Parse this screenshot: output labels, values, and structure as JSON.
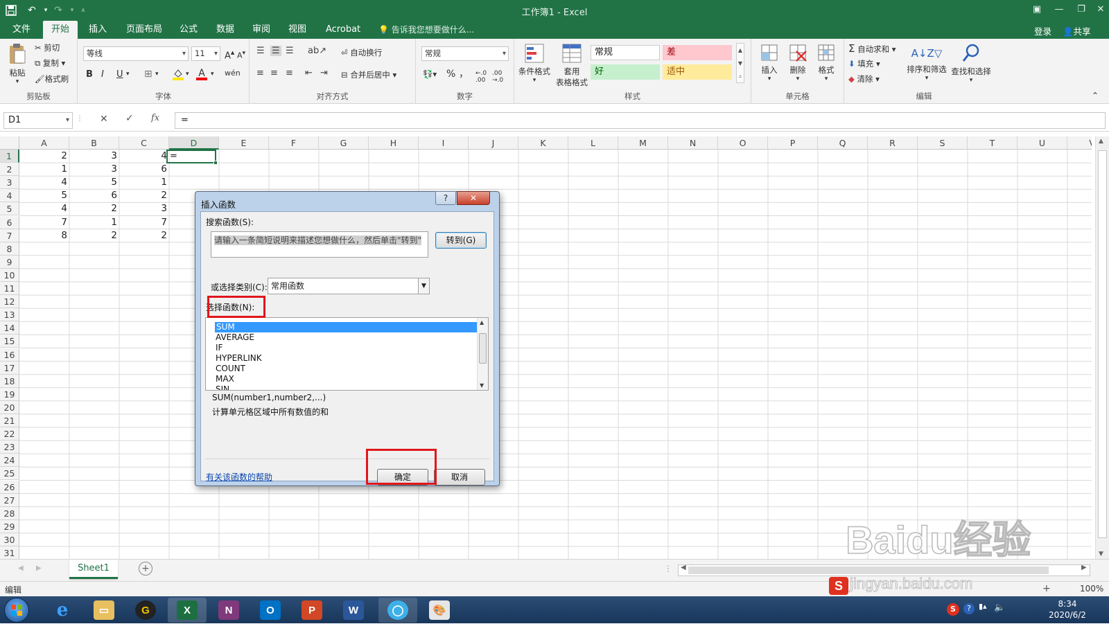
{
  "window": {
    "title": "工作簿1 - Excel"
  },
  "ribbon_tabs": [
    "文件",
    "开始",
    "插入",
    "页面布局",
    "公式",
    "数据",
    "审阅",
    "视图",
    "Acrobat"
  ],
  "tell_me": "告诉我您想要做什么...",
  "account": {
    "login": "登录",
    "share": "共享"
  },
  "clipboard": {
    "paste": "粘贴",
    "cut": "剪切",
    "copy": "复制",
    "format_painter": "格式刷",
    "label": "剪贴板"
  },
  "font": {
    "name": "等线",
    "size": "11",
    "label": "字体",
    "bold": "B",
    "italic": "I",
    "underline": "U"
  },
  "alignment": {
    "wrap": "自动换行",
    "merge": "合并后居中",
    "label": "对齐方式"
  },
  "number": {
    "format": "常规",
    "percent": "%",
    "comma": "，",
    "label": "数字"
  },
  "styles": {
    "conditional": "条件格式",
    "table1": "套用",
    "table2": "表格格式",
    "normal": "常规",
    "bad": "差",
    "good": "好",
    "neutral": "适中",
    "label": "样式"
  },
  "cells": {
    "insert": "插入",
    "delete": "删除",
    "format": "格式",
    "label": "单元格"
  },
  "editing": {
    "autosum": "自动求和",
    "fill": "填充",
    "clear": "清除",
    "sort": "排序和筛选",
    "find": "查找和选择",
    "label": "编辑"
  },
  "formula_bar": {
    "name_box": "D1",
    "fx": "fx",
    "content": "="
  },
  "columns": [
    "A",
    "B",
    "C",
    "D",
    "E",
    "F",
    "G",
    "H",
    "I",
    "J",
    "K",
    "L",
    "M",
    "N",
    "O",
    "P",
    "Q",
    "R",
    "S",
    "T",
    "U",
    "V"
  ],
  "rows": [
    "1",
    "2",
    "3",
    "4",
    "5",
    "6",
    "7",
    "8",
    "9",
    "10",
    "11",
    "12",
    "13",
    "14",
    "15",
    "16",
    "17",
    "18",
    "19",
    "20",
    "21",
    "22",
    "23",
    "24",
    "25",
    "26",
    "27",
    "28",
    "29",
    "30",
    "31"
  ],
  "sheet_values": [
    [
      "2",
      "3",
      "4"
    ],
    [
      "1",
      "3",
      "6"
    ],
    [
      "4",
      "5",
      "1"
    ],
    [
      "5",
      "6",
      "2"
    ],
    [
      "4",
      "2",
      "3"
    ],
    [
      "7",
      "1",
      "7"
    ],
    [
      "8",
      "2",
      "2"
    ]
  ],
  "active_cell": {
    "text": "="
  },
  "sheet_tabs": [
    "Sheet1"
  ],
  "status": {
    "mode": "编辑",
    "zoom": "100%"
  },
  "taskbar": {
    "time": "8:34",
    "date": "2020/6/2"
  },
  "dialog": {
    "title": "插入函数",
    "help_button": "?",
    "close_button": "✕",
    "search_label": "搜索函数(S):",
    "search_text": "请输入一条简短说明来描述您想做什么，然后单击\"转到\"",
    "go_button": "转到(G)",
    "category_label": "或选择类别(C):",
    "category_value": "常用函数",
    "select_label": "选择函数(N):",
    "functions": [
      "SUM",
      "AVERAGE",
      "IF",
      "HYPERLINK",
      "COUNT",
      "MAX",
      "SIN"
    ],
    "signature": "SUM(number1,number2,...)",
    "description": "计算单元格区域中所有数值的和",
    "help_link": "有关该函数的帮助",
    "ok_button": "确定",
    "cancel_button": "取消"
  },
  "watermark": {
    "text": "Baidu经验",
    "url": "jingyan.baidu.com"
  },
  "colors": {
    "excel_green": "#217346",
    "highlight_red": "#e0161c",
    "selection_blue": "#3399ff"
  }
}
